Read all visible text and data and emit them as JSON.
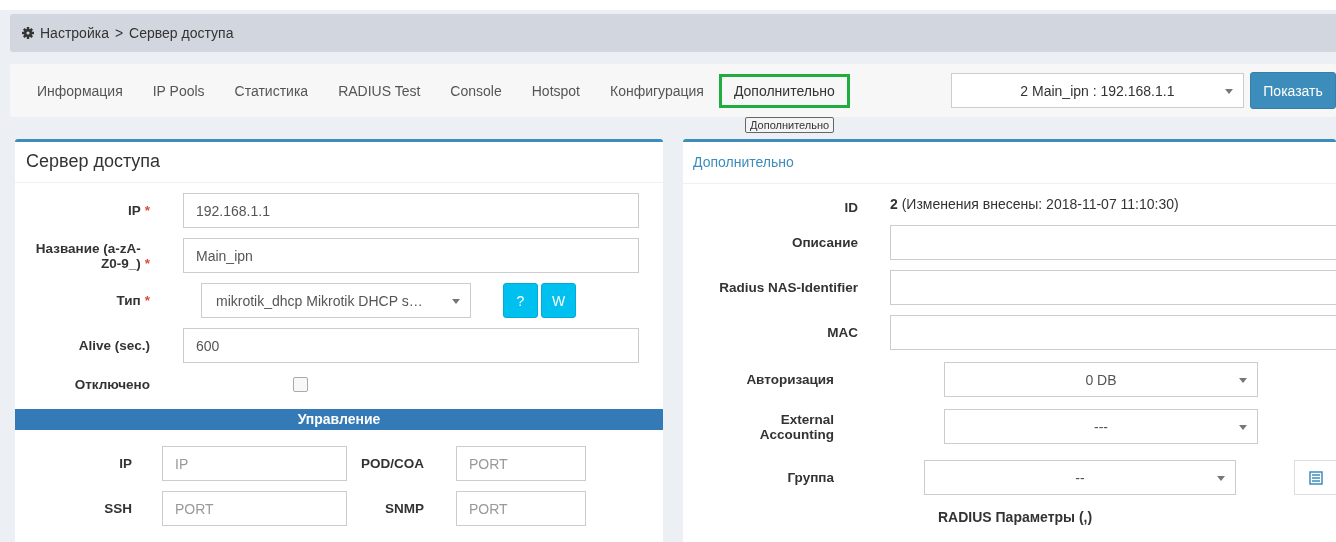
{
  "breadcrumb": {
    "items": [
      "Настройка",
      "Сервер доступа"
    ],
    "separator": ">"
  },
  "tabs": [
    {
      "label": "Информация",
      "selected": false
    },
    {
      "label": "IP Pools",
      "selected": false
    },
    {
      "label": "Статистика",
      "selected": false
    },
    {
      "label": "RADIUS Test",
      "selected": false
    },
    {
      "label": "Console",
      "selected": false
    },
    {
      "label": "Hotspot",
      "selected": false
    },
    {
      "label": "Конфигурация",
      "selected": false
    },
    {
      "label": "Дополнительно",
      "selected": true
    }
  ],
  "tooltip": "Дополнительно",
  "server_select": {
    "value": "2 Main_ipn : 192.168.1.1"
  },
  "show_button": "Показать",
  "left_panel": {
    "title": "Сервер доступа",
    "required_mark": "*",
    "fields": [
      {
        "kind": "input",
        "label": "IP",
        "required": true,
        "value": "192.168.1.1"
      },
      {
        "kind": "input",
        "label": "Название (a-zA-Z0-9_)",
        "required": true,
        "value": "Main_ipn"
      },
      {
        "kind": "select",
        "label": "Тип",
        "required": true,
        "value": "mikrotik_dhcp Mikrotik DHCP s…",
        "buttons": [
          "?",
          "W"
        ]
      },
      {
        "kind": "input",
        "label": "Alive (sec.)",
        "required": false,
        "value": "600"
      },
      {
        "kind": "checkbox",
        "label": "Отключено",
        "required": false,
        "checked": false
      }
    ]
  },
  "management": {
    "title": "Управление",
    "fields": [
      {
        "label": "IP",
        "placeholder": "IP"
      },
      {
        "label": "POD/COA",
        "placeholder": "PORT"
      },
      {
        "label": "SSH",
        "placeholder": "PORT"
      },
      {
        "label": "SNMP",
        "placeholder": "PORT"
      }
    ]
  },
  "right_panel": {
    "title": "Дополнительно",
    "fields": [
      {
        "kind": "text",
        "label": "ID",
        "value": "**2** (Изменения внесены: 2018-11-07 11:10:30)"
      },
      {
        "kind": "input",
        "label": "Описание"
      },
      {
        "kind": "input",
        "label": "Radius NAS-Identifier"
      },
      {
        "kind": "input",
        "label": "MAC"
      },
      {
        "kind": "select",
        "label": "Авторизация",
        "value": "0 DB"
      },
      {
        "kind": "select",
        "label": "External Accounting",
        "value": "---"
      },
      {
        "kind": "select_list",
        "label": "Группа",
        "value": "--"
      }
    ],
    "section": "RADIUS Параметры (,)"
  }
}
